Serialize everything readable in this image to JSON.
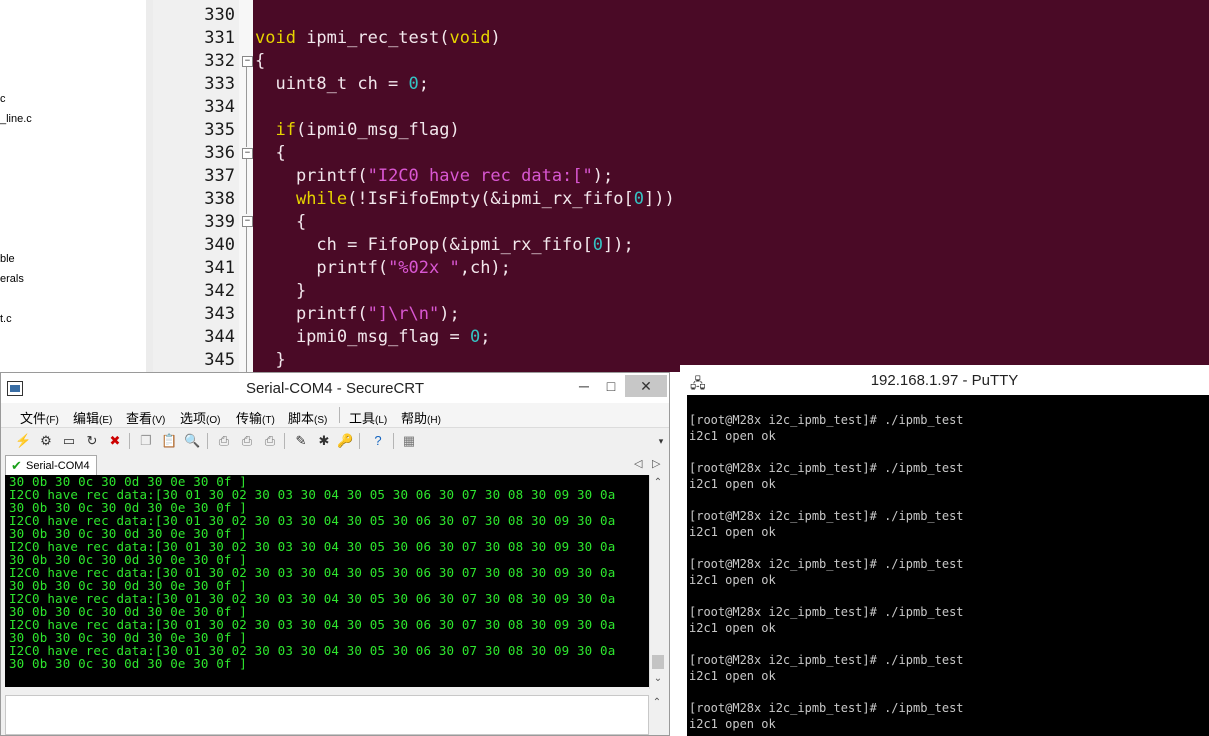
{
  "file_tree": {
    "items": [
      "c",
      "_line.c",
      "ble",
      "erals",
      "t.c"
    ]
  },
  "editor": {
    "line_numbers": [
      "330",
      "331",
      "332",
      "333",
      "334",
      "335",
      "336",
      "337",
      "338",
      "339",
      "340",
      "341",
      "342",
      "343",
      "344",
      "345"
    ],
    "lines": [
      [],
      [
        {
          "t": "void",
          "c": "kw"
        },
        {
          "t": " ipmi_rec_test(",
          "c": "pl"
        },
        {
          "t": "void",
          "c": "kw"
        },
        {
          "t": ")",
          "c": "pl"
        }
      ],
      [
        {
          "t": "{",
          "c": "pl"
        }
      ],
      [
        {
          "t": "  uint8_t ch = ",
          "c": "pl"
        },
        {
          "t": "0",
          "c": "num"
        },
        {
          "t": ";",
          "c": "pl"
        }
      ],
      [],
      [
        {
          "t": "  ",
          "c": "pl"
        },
        {
          "t": "if",
          "c": "kw"
        },
        {
          "t": "(ipmi0_msg_flag)",
          "c": "pl"
        }
      ],
      [
        {
          "t": "  {",
          "c": "pl"
        }
      ],
      [
        {
          "t": "    printf(",
          "c": "pl"
        },
        {
          "t": "\"I2C0 have rec data:[\"",
          "c": "str"
        },
        {
          "t": ");",
          "c": "pl"
        }
      ],
      [
        {
          "t": "    ",
          "c": "pl"
        },
        {
          "t": "while",
          "c": "kw"
        },
        {
          "t": "(!IsFifoEmpty(&ipmi_rx_fifo[",
          "c": "pl"
        },
        {
          "t": "0",
          "c": "num"
        },
        {
          "t": "]))",
          "c": "pl"
        }
      ],
      [
        {
          "t": "    {",
          "c": "pl"
        }
      ],
      [
        {
          "t": "      ch = FifoPop(&ipmi_rx_fifo[",
          "c": "pl"
        },
        {
          "t": "0",
          "c": "num"
        },
        {
          "t": "]);",
          "c": "pl"
        }
      ],
      [
        {
          "t": "      printf(",
          "c": "pl"
        },
        {
          "t": "\"%02x \"",
          "c": "str"
        },
        {
          "t": ",ch);",
          "c": "pl"
        }
      ],
      [
        {
          "t": "    }",
          "c": "pl"
        }
      ],
      [
        {
          "t": "    printf(",
          "c": "pl"
        },
        {
          "t": "\"]\\r\\n\"",
          "c": "str"
        },
        {
          "t": ");",
          "c": "pl"
        }
      ],
      [
        {
          "t": "    ipmi0_msg_flag = ",
          "c": "pl"
        },
        {
          "t": "0",
          "c": "num"
        },
        {
          "t": ";",
          "c": "pl"
        }
      ],
      [
        {
          "t": "  }",
          "c": "pl"
        }
      ]
    ]
  },
  "securecrt": {
    "title": "Serial-COM4 - SecureCRT",
    "window_buttons": {
      "minimize": "─",
      "maximize": "□",
      "close": "✕"
    },
    "menu": [
      {
        "label": "文件",
        "key": "(F)"
      },
      {
        "label": "编辑",
        "key": "(E)"
      },
      {
        "label": "查看",
        "key": "(V)"
      },
      {
        "label": "选项",
        "key": "(O)"
      },
      {
        "label": "传输",
        "key": "(T)"
      },
      {
        "label": "脚本",
        "key": "(S)"
      },
      {
        "label": "工具",
        "key": "(L)"
      },
      {
        "label": "帮助",
        "key": "(H)"
      }
    ],
    "tab_label": "Serial-COM4",
    "terminal_lines": [
      "30 0b 30 0c 30 0d 30 0e 30 0f ]",
      "I2C0 have rec data:[30 01 30 02 30 03 30 04 30 05 30 06 30 07 30 08 30 09 30 0a",
      "30 0b 30 0c 30 0d 30 0e 30 0f ]",
      "I2C0 have rec data:[30 01 30 02 30 03 30 04 30 05 30 06 30 07 30 08 30 09 30 0a",
      "30 0b 30 0c 30 0d 30 0e 30 0f ]",
      "I2C0 have rec data:[30 01 30 02 30 03 30 04 30 05 30 06 30 07 30 08 30 09 30 0a",
      "30 0b 30 0c 30 0d 30 0e 30 0f ]",
      "I2C0 have rec data:[30 01 30 02 30 03 30 04 30 05 30 06 30 07 30 08 30 09 30 0a",
      "30 0b 30 0c 30 0d 30 0e 30 0f ]",
      "I2C0 have rec data:[30 01 30 02 30 03 30 04 30 05 30 06 30 07 30 08 30 09 30 0a",
      "30 0b 30 0c 30 0d 30 0e 30 0f ]",
      "I2C0 have rec data:[30 01 30 02 30 03 30 04 30 05 30 06 30 07 30 08 30 09 30 0a",
      "30 0b 30 0c 30 0d 30 0e 30 0f ]",
      "I2C0 have rec data:[30 01 30 02 30 03 30 04 30 05 30 06 30 07 30 08 30 09 30 0a",
      "30 0b 30 0c 30 0d 30 0e 30 0f ]"
    ]
  },
  "putty": {
    "title": "192.168.1.97 - PuTTY",
    "terminal_lines": [
      "[root@M28x i2c_ipmb_test]# ./ipmb_test",
      "i2c1 open ok",
      "",
      "[root@M28x i2c_ipmb_test]# ./ipmb_test",
      "i2c1 open ok",
      "",
      "[root@M28x i2c_ipmb_test]# ./ipmb_test",
      "i2c1 open ok",
      "",
      "[root@M28x i2c_ipmb_test]# ./ipmb_test",
      "i2c1 open ok",
      "",
      "[root@M28x i2c_ipmb_test]# ./ipmb_test",
      "i2c1 open ok",
      "",
      "[root@M28x i2c_ipmb_test]# ./ipmb_test",
      "i2c1 open ok",
      "",
      "[root@M28x i2c_ipmb_test]# ./ipmb_test",
      "i2c1 open ok"
    ]
  },
  "colors": {
    "code_background": "#4a0a26",
    "keyword": "#e6d400",
    "string": "#d957d2",
    "number": "#35c3c3",
    "serial_text": "#2ee62e"
  }
}
